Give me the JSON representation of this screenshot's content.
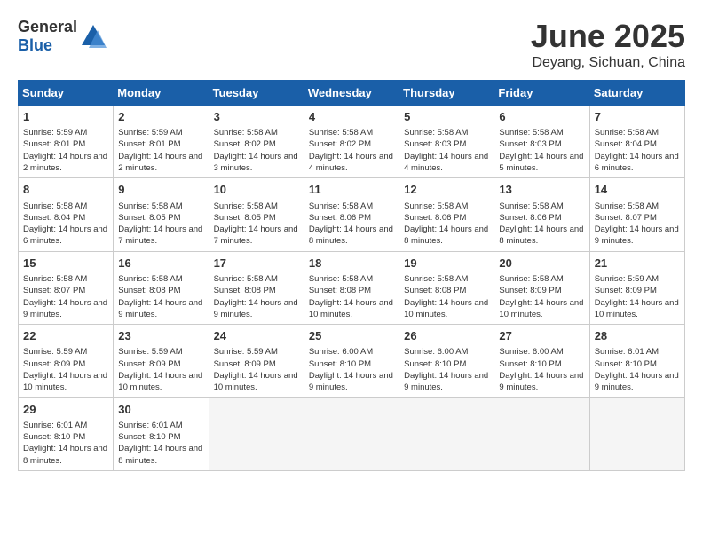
{
  "logo": {
    "general": "General",
    "blue": "Blue"
  },
  "header": {
    "month": "June 2025",
    "location": "Deyang, Sichuan, China"
  },
  "weekdays": [
    "Sunday",
    "Monday",
    "Tuesday",
    "Wednesday",
    "Thursday",
    "Friday",
    "Saturday"
  ],
  "days": [
    {
      "day": "1",
      "sunrise": "5:59 AM",
      "sunset": "8:01 PM",
      "daylight": "14 hours and 2 minutes."
    },
    {
      "day": "2",
      "sunrise": "5:59 AM",
      "sunset": "8:01 PM",
      "daylight": "14 hours and 2 minutes."
    },
    {
      "day": "3",
      "sunrise": "5:58 AM",
      "sunset": "8:02 PM",
      "daylight": "14 hours and 3 minutes."
    },
    {
      "day": "4",
      "sunrise": "5:58 AM",
      "sunset": "8:02 PM",
      "daylight": "14 hours and 4 minutes."
    },
    {
      "day": "5",
      "sunrise": "5:58 AM",
      "sunset": "8:03 PM",
      "daylight": "14 hours and 4 minutes."
    },
    {
      "day": "6",
      "sunrise": "5:58 AM",
      "sunset": "8:03 PM",
      "daylight": "14 hours and 5 minutes."
    },
    {
      "day": "7",
      "sunrise": "5:58 AM",
      "sunset": "8:04 PM",
      "daylight": "14 hours and 6 minutes."
    },
    {
      "day": "8",
      "sunrise": "5:58 AM",
      "sunset": "8:04 PM",
      "daylight": "14 hours and 6 minutes."
    },
    {
      "day": "9",
      "sunrise": "5:58 AM",
      "sunset": "8:05 PM",
      "daylight": "14 hours and 7 minutes."
    },
    {
      "day": "10",
      "sunrise": "5:58 AM",
      "sunset": "8:05 PM",
      "daylight": "14 hours and 7 minutes."
    },
    {
      "day": "11",
      "sunrise": "5:58 AM",
      "sunset": "8:06 PM",
      "daylight": "14 hours and 8 minutes."
    },
    {
      "day": "12",
      "sunrise": "5:58 AM",
      "sunset": "8:06 PM",
      "daylight": "14 hours and 8 minutes."
    },
    {
      "day": "13",
      "sunrise": "5:58 AM",
      "sunset": "8:06 PM",
      "daylight": "14 hours and 8 minutes."
    },
    {
      "day": "14",
      "sunrise": "5:58 AM",
      "sunset": "8:07 PM",
      "daylight": "14 hours and 9 minutes."
    },
    {
      "day": "15",
      "sunrise": "5:58 AM",
      "sunset": "8:07 PM",
      "daylight": "14 hours and 9 minutes."
    },
    {
      "day": "16",
      "sunrise": "5:58 AM",
      "sunset": "8:08 PM",
      "daylight": "14 hours and 9 minutes."
    },
    {
      "day": "17",
      "sunrise": "5:58 AM",
      "sunset": "8:08 PM",
      "daylight": "14 hours and 9 minutes."
    },
    {
      "day": "18",
      "sunrise": "5:58 AM",
      "sunset": "8:08 PM",
      "daylight": "14 hours and 10 minutes."
    },
    {
      "day": "19",
      "sunrise": "5:58 AM",
      "sunset": "8:08 PM",
      "daylight": "14 hours and 10 minutes."
    },
    {
      "day": "20",
      "sunrise": "5:58 AM",
      "sunset": "8:09 PM",
      "daylight": "14 hours and 10 minutes."
    },
    {
      "day": "21",
      "sunrise": "5:59 AM",
      "sunset": "8:09 PM",
      "daylight": "14 hours and 10 minutes."
    },
    {
      "day": "22",
      "sunrise": "5:59 AM",
      "sunset": "8:09 PM",
      "daylight": "14 hours and 10 minutes."
    },
    {
      "day": "23",
      "sunrise": "5:59 AM",
      "sunset": "8:09 PM",
      "daylight": "14 hours and 10 minutes."
    },
    {
      "day": "24",
      "sunrise": "5:59 AM",
      "sunset": "8:09 PM",
      "daylight": "14 hours and 10 minutes."
    },
    {
      "day": "25",
      "sunrise": "6:00 AM",
      "sunset": "8:10 PM",
      "daylight": "14 hours and 9 minutes."
    },
    {
      "day": "26",
      "sunrise": "6:00 AM",
      "sunset": "8:10 PM",
      "daylight": "14 hours and 9 minutes."
    },
    {
      "day": "27",
      "sunrise": "6:00 AM",
      "sunset": "8:10 PM",
      "daylight": "14 hours and 9 minutes."
    },
    {
      "day": "28",
      "sunrise": "6:01 AM",
      "sunset": "8:10 PM",
      "daylight": "14 hours and 9 minutes."
    },
    {
      "day": "29",
      "sunrise": "6:01 AM",
      "sunset": "8:10 PM",
      "daylight": "14 hours and 8 minutes."
    },
    {
      "day": "30",
      "sunrise": "6:01 AM",
      "sunset": "8:10 PM",
      "daylight": "14 hours and 8 minutes."
    }
  ]
}
